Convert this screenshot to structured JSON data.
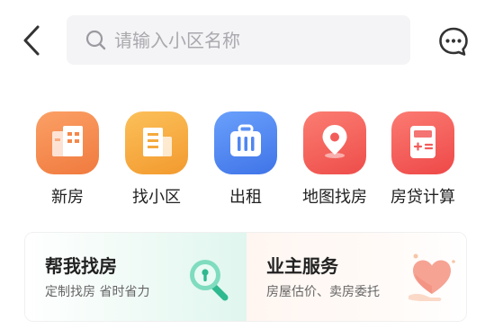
{
  "topbar": {
    "back_icon": "chevron-left-icon",
    "search_placeholder": "请输入小区名称",
    "message_icon": "chat-bubble-icon"
  },
  "categories": [
    {
      "label": "新房",
      "icon": "new-building-icon",
      "color": "#f58a4c"
    },
    {
      "label": "找小区",
      "icon": "community-building-icon",
      "color": "#f4a93e"
    },
    {
      "label": "出租",
      "icon": "luggage-icon",
      "color": "#4f86f0"
    },
    {
      "label": "地图找房",
      "icon": "map-pin-icon",
      "color": "#f25d5a"
    },
    {
      "label": "房贷计算",
      "icon": "calculator-icon",
      "color": "#f25b5b"
    }
  ],
  "cards": {
    "find_home": {
      "title": "帮我找房",
      "subtitle": "定制找房 省时省力",
      "icon": "magnifier-key-icon",
      "accent": "#3cc9a0"
    },
    "owner_service": {
      "title": "业主服务",
      "subtitle": "房屋估价、卖房委托",
      "icon": "heart-hand-icon",
      "accent": "#f07a6a"
    }
  }
}
